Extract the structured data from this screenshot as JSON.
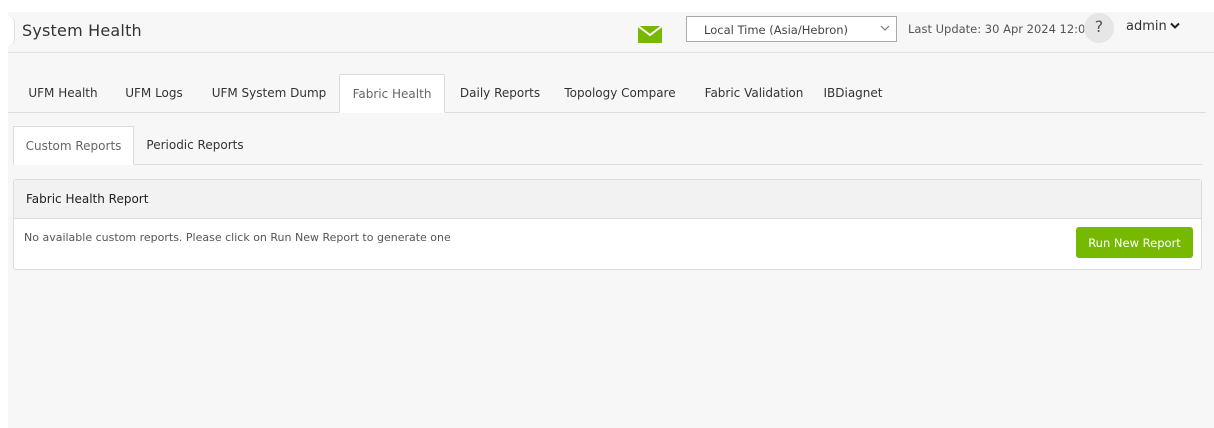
{
  "header": {
    "title": "System Health",
    "notification_icon": "envelope-icon",
    "timezone": {
      "selected": "Local Time (Asia/Hebron)"
    },
    "last_update": "Last Update: 30 Apr 2024 12:04",
    "help_label": "?",
    "user": "admin"
  },
  "main_tabs": [
    {
      "label": "UFM Health"
    },
    {
      "label": "UFM Logs"
    },
    {
      "label": "UFM System Dump"
    },
    {
      "label": "Fabric Health",
      "active": true
    },
    {
      "label": "Daily Reports"
    },
    {
      "label": "Topology Compare"
    },
    {
      "label": "Fabric Validation"
    },
    {
      "label": "IBDiagnet"
    }
  ],
  "sub_tabs": [
    {
      "label": "Custom Reports",
      "active": true
    },
    {
      "label": "Periodic Reports"
    }
  ],
  "panel": {
    "title": "Fabric Health Report",
    "message": "No available custom reports. Please click on Run New Report to generate one",
    "run_button": "Run New Report"
  },
  "colors": {
    "accent_green": "#76b900",
    "background": "#f7f7f7"
  }
}
